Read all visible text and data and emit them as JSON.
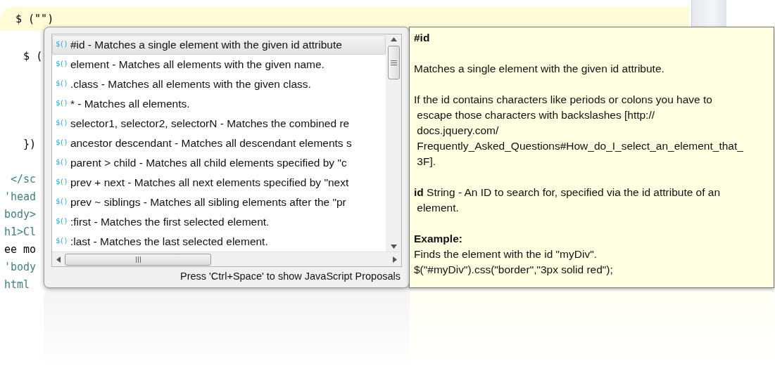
{
  "editor": {
    "current_line": "$ (\"\")",
    "code_lines": [
      {
        "text": "   $ (",
        "kind": "code"
      },
      {
        "kind": "blank"
      },
      {
        "kind": "blank"
      },
      {
        "kind": "blank"
      },
      {
        "kind": "blank"
      },
      {
        "text": "   })",
        "kind": "code"
      },
      {
        "kind": "blank"
      },
      {
        "text": " </sc",
        "kind": "markup"
      },
      {
        "text": "'head",
        "kind": "markup"
      },
      {
        "text": "body>",
        "kind": "markup"
      },
      {
        "text": "h1>Cl",
        "kind": "markup"
      },
      {
        "text": "ee mo",
        "kind": "code"
      },
      {
        "text": "'body",
        "kind": "markup"
      },
      {
        "text": "html",
        "kind": "markup"
      }
    ]
  },
  "proposals": {
    "items": [
      {
        "icon": "$()",
        "label": "#id - Matches a single element with the given id attribute",
        "selected": true
      },
      {
        "icon": "$()",
        "label": "element - Matches all elements with the given name.",
        "selected": false
      },
      {
        "icon": "$()",
        "label": ".class - Matches all elements with the given class.",
        "selected": false
      },
      {
        "icon": "$()",
        "label": "* - Matches all elements.",
        "selected": false
      },
      {
        "icon": "$()",
        "label": "selector1, selector2, selectorN - Matches the combined re",
        "selected": false
      },
      {
        "icon": "$()",
        "label": "ancestor descendant - Matches all descendant elements s",
        "selected": false
      },
      {
        "icon": "$()",
        "label": "parent > child - Matches all child elements specified by \"c",
        "selected": false
      },
      {
        "icon": "$()",
        "label": "prev + next - Matches all next elements specified by \"next",
        "selected": false
      },
      {
        "icon": "$()",
        "label": "prev ~ siblings - Matches all sibling elements after the \"pr",
        "selected": false
      },
      {
        "icon": "$()",
        "label": ":first - Matches the first selected element.",
        "selected": false
      },
      {
        "icon": "$()",
        "label": ":last - Matches the last selected element.",
        "selected": false
      }
    ],
    "status": "Press 'Ctrl+Space' to show JavaScript Proposals"
  },
  "documentation": {
    "blocks": [
      {
        "kind": "heading",
        "lines": [
          "#id"
        ]
      },
      {
        "kind": "text",
        "lines": [
          "Matches a single element with the given id attribute."
        ]
      },
      {
        "kind": "text",
        "lines": [
          "If the id contains characters like periods or colons you have to",
          " escape those characters with backslashes [http://",
          " docs.jquery.com/",
          " Frequently_Asked_Questions#How_do_I_select_an_element_that_",
          " 3F]."
        ]
      },
      {
        "kind": "text",
        "lines": [
          "**id** String - An ID to search for, specified via the id attribute of an",
          " element."
        ]
      },
      {
        "kind": "example",
        "title": "Example:",
        "lines": [
          "Finds the element with the id \"myDiv\".",
          "$(\"#myDiv\").css(\"border\",\"3px solid red\");"
        ]
      }
    ]
  }
}
